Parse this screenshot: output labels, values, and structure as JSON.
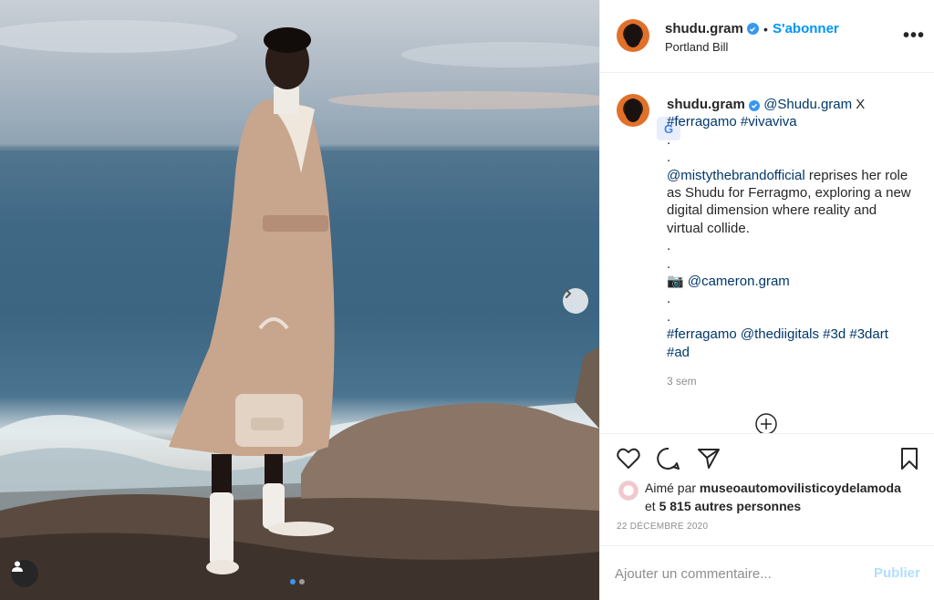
{
  "post": {
    "username": "shudu.gram",
    "follow_label": "S'abonner",
    "separator": "•",
    "location": "Portland Bill",
    "more_label": "•••",
    "caption": {
      "username": "shudu.gram",
      "line1_mention": "@Shudu.gram",
      "line1_rest": " X",
      "line2_tag1": "#ferragamo",
      "line2_tag2": "#vivaviva",
      "dot": ".",
      "body_mention": "@mistythebrandofficial",
      "body_text": " reprises her role as Shudu for Ferragmo, exploring a new digital dimension where reality and virtual collide.",
      "camera_glyph": "📷",
      "camera_mention": "@cameron.gram",
      "tags": [
        "#ferragamo",
        "@thediigitals",
        "#3d",
        "#3dart",
        "#ad"
      ]
    },
    "time_ago": "3 sem",
    "likes": {
      "prefix": "Aimé par ",
      "liker": "museoautomovilisticoydelamoda",
      "middle": "et ",
      "others": "5 815 autres personnes"
    },
    "date": "22 DÉCEMBRE 2020",
    "comment": {
      "placeholder": "Ajouter un commentaire...",
      "publish_label": "Publier"
    },
    "carousel": {
      "count": 2,
      "active_index": 0
    },
    "translate_glyph": "G"
  },
  "colors": {
    "accent": "#0095f6",
    "link": "#00376b",
    "muted": "#8e8e8e",
    "verified": "#3897f0",
    "publish_disabled": "#b2dffc"
  }
}
